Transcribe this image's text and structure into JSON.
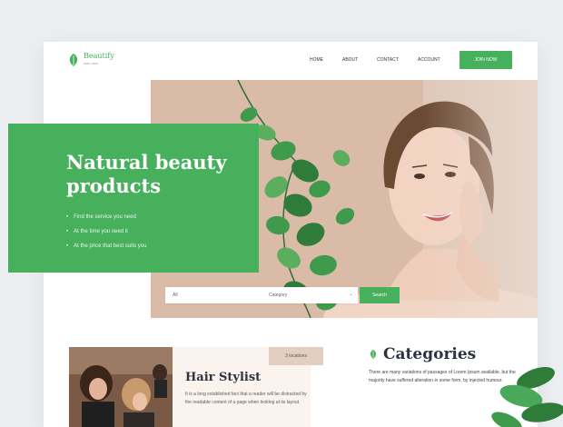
{
  "brand": {
    "name": "Beautify",
    "tagline": "skin care"
  },
  "nav": {
    "items": [
      "HOME",
      "ABOUT",
      "CONTACT",
      "ACCOUNT"
    ],
    "join_label": "JOIN NOW"
  },
  "hero": {
    "title": "Natural beauty products",
    "bullets": [
      "Find the service you need",
      "At the time you need it",
      "At the price that best suits you"
    ]
  },
  "search": {
    "all_label": "All",
    "category_label": "Category",
    "button_label": "Search"
  },
  "stylist": {
    "badge": "3 locations",
    "title": "Hair Stylist",
    "description": "It is a long established fact that a reader will be distracted by the readable content of a page when looking at its layout."
  },
  "categories": {
    "title": "Categories",
    "description": "There are many variations of passages of Lorem Ipsum available, but the majority have suffered alteration in some form, by injected humour."
  },
  "colors": {
    "accent": "#46b05c",
    "hero_bg": "#d9bba7",
    "background": "#eceef1",
    "card_bg": "#fbf3ee"
  },
  "icons": [
    "leaf-logo-icon",
    "chevron-down-icon",
    "leaf-icon"
  ]
}
